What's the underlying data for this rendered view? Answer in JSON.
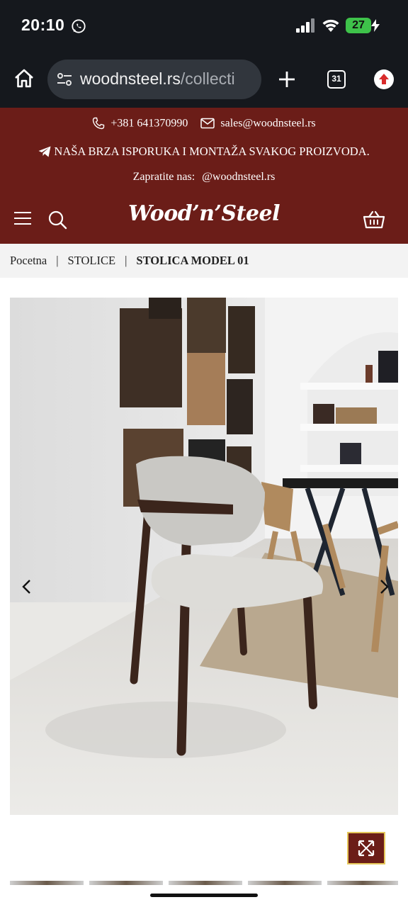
{
  "status_bar": {
    "time": "20:10",
    "battery": "27",
    "icons": [
      "whatsapp-icon",
      "signal-icon",
      "wifi-icon",
      "battery-icon",
      "charging-bolt-icon"
    ]
  },
  "browser": {
    "url_domain": "woodnsteel.rs",
    "url_path": "/collecti",
    "tab_count": "31",
    "icons": [
      "home-icon",
      "site-settings-icon",
      "plus-icon",
      "tabs-icon",
      "menu-icon"
    ]
  },
  "topbar": {
    "phone": "+381 641370990",
    "email": "sales@woodnsteel.rs",
    "delivery_text": "NAŠA BRZA ISPORUKA I MONTAŽA SVAKOG PROIZVODA.",
    "follow_label": "Zapratite nas:",
    "follow_handle": "@woodnsteel.rs"
  },
  "header": {
    "logo": "Wood’n’Steel"
  },
  "breadcrumb": {
    "items": [
      "Pocetna",
      "STOLICE"
    ],
    "separator": "|",
    "current": "STOLICA MODEL 01"
  },
  "colors": {
    "brand": "#6b1d18",
    "zoom_border": "#e5c75a",
    "status_bg": "#15181d",
    "battery": "#3ec24a"
  }
}
